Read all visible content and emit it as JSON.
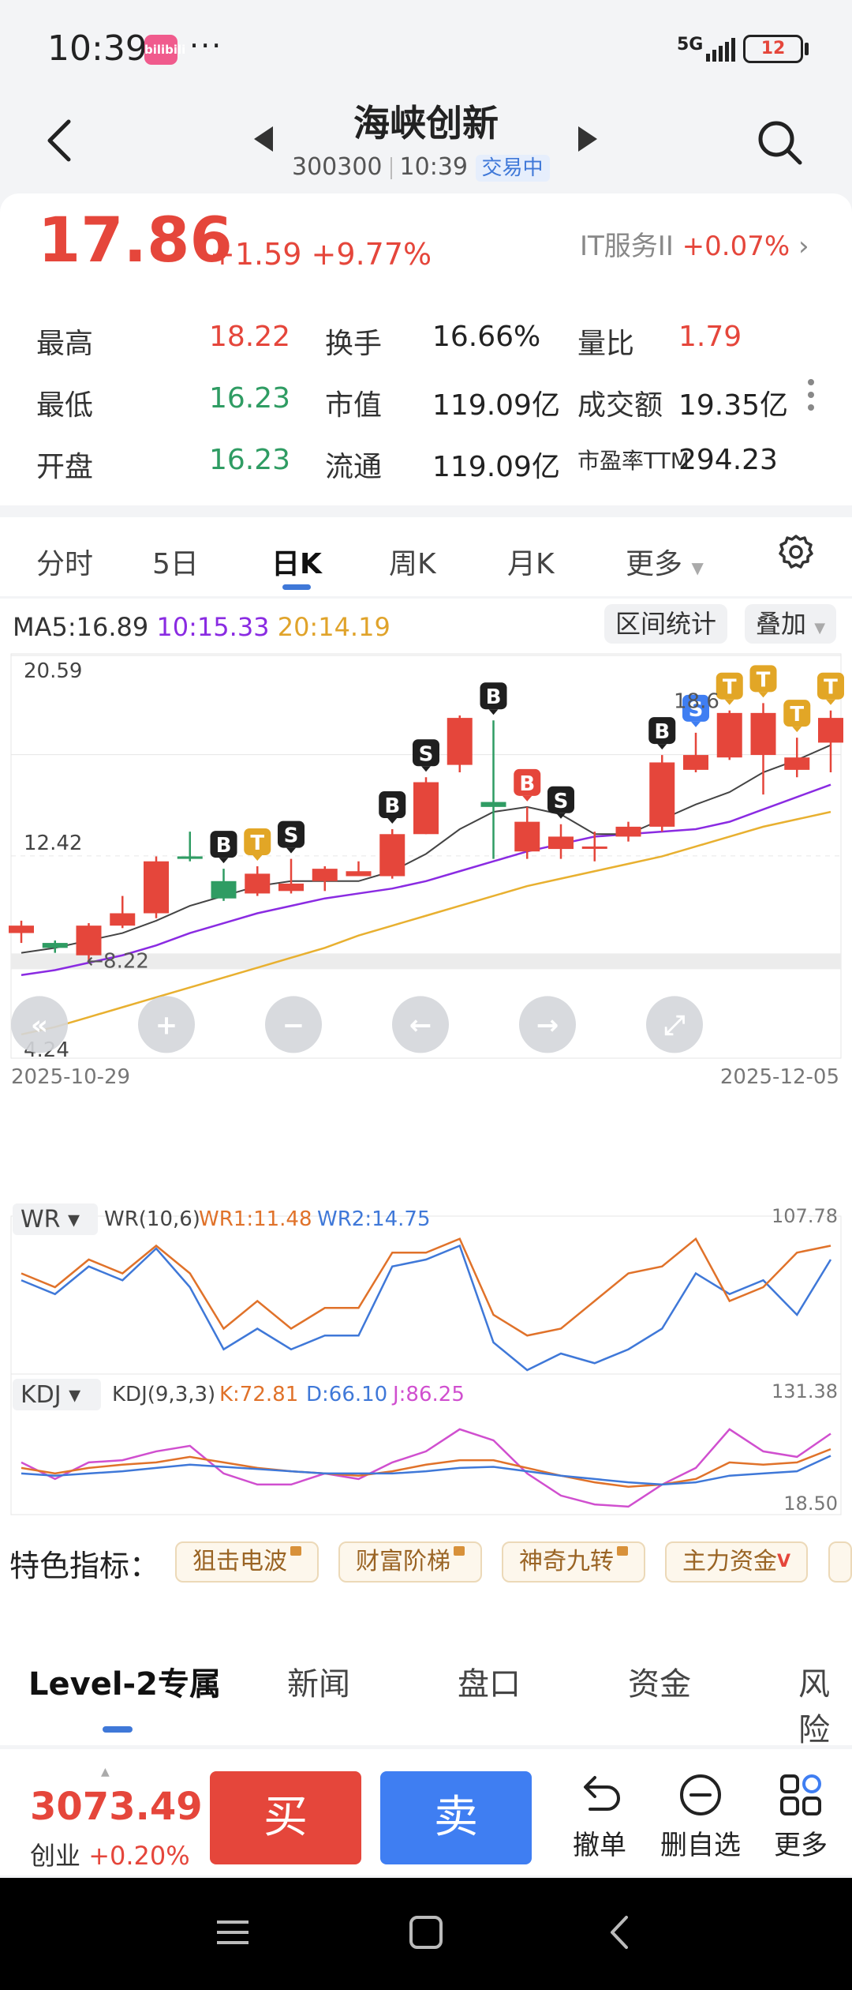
{
  "status": {
    "time": "10:39",
    "app_badge": "bilibili",
    "more": "···",
    "network": "5G",
    "battery": "12"
  },
  "header": {
    "name": "海峡创新",
    "code": "300300",
    "time": "10:39",
    "state": "交易中"
  },
  "quote": {
    "price": "17.86",
    "change": "+1.59",
    "change_pct": "+9.77%",
    "sector": "IT服务II",
    "sector_chg": "+0.07%",
    "rows": [
      {
        "l1": "最高",
        "v1": "18.22",
        "l2": "换手",
        "v2": "16.66%",
        "l3": "量比",
        "v3": "1.79"
      },
      {
        "l1": "最低",
        "v1": "16.23",
        "l2": "市值",
        "v2": "119.09亿",
        "l3": "成交额",
        "v3": "19.35亿"
      },
      {
        "l1": "开盘",
        "v1": "16.23",
        "l2": "流通",
        "v2": "119.09亿",
        "l3": "市盈率TTM",
        "v3": "294.23"
      }
    ]
  },
  "tabs": [
    "分时",
    "5日",
    "日K",
    "周K",
    "月K",
    "更多"
  ],
  "active_tab": "日K",
  "ma": {
    "ma5": "MA5:16.89",
    "ma10": "10:15.33",
    "ma20": "20:14.19",
    "range_btn": "区间统计",
    "overlay_btn": "叠加"
  },
  "chart_labels": {
    "ymax": "20.59",
    "ymid": "12.42",
    "ymin": "4.24",
    "low_mark": "8.22",
    "high_mark": "18.6",
    "date_start": "2025-10-29",
    "date_end": "2025-12-05"
  },
  "wr": {
    "name": "WR",
    "params": "WR(10,6)",
    "wr1": "WR1:11.48",
    "wr2": "WR2:14.75",
    "max": "107.78"
  },
  "kdj": {
    "name": "KDJ",
    "params": "KDJ(9,3,3)",
    "k": "K:72.81",
    "d": "D:66.10",
    "j": "J:86.25",
    "max": "131.38",
    "min": "18.50"
  },
  "features": {
    "label": "特色指标：",
    "chips": [
      "狙击电波",
      "财富阶梯",
      "神奇九转",
      "主力资金"
    ]
  },
  "news_tabs": [
    "Level-2专属",
    "新闻",
    "盘口",
    "资金",
    "风险"
  ],
  "bottom": {
    "index_value": "3073.49",
    "index_name": "创业",
    "index_chg": "+0.20%",
    "buy": "买",
    "sell": "卖",
    "actions": [
      "撤单",
      "删自选",
      "更多"
    ]
  },
  "colors": {
    "up": "#e5463b",
    "down": "#2f9c63",
    "ma5": "#444444",
    "ma10": "#8a2be2",
    "ma20": "#e8b030",
    "accent": "#3f78d8"
  },
  "chart_data": {
    "type": "candlestick",
    "ohlc": [
      [
        9.3,
        9.6,
        8.9,
        9.8
      ],
      [
        8.9,
        8.7,
        8.5,
        9.0
      ],
      [
        8.4,
        9.6,
        8.2,
        9.7
      ],
      [
        9.6,
        10.1,
        9.5,
        10.8
      ],
      [
        10.1,
        12.2,
        9.9,
        12.4
      ],
      [
        12.4,
        12.3,
        12.2,
        13.4
      ],
      [
        11.4,
        10.7,
        10.6,
        11.9
      ],
      [
        10.9,
        11.7,
        10.8,
        12.0
      ],
      [
        11.0,
        11.3,
        10.9,
        12.3
      ],
      [
        11.4,
        11.9,
        11.0,
        12.0
      ],
      [
        11.6,
        11.8,
        11.6,
        12.2
      ],
      [
        11.6,
        13.3,
        11.5,
        13.5
      ],
      [
        13.3,
        15.4,
        13.3,
        15.6
      ],
      [
        16.1,
        18.0,
        15.8,
        18.1
      ],
      [
        14.6,
        14.4,
        12.3,
        17.9
      ],
      [
        12.6,
        13.8,
        12.3,
        14.4
      ],
      [
        12.7,
        13.2,
        12.3,
        13.7
      ],
      [
        12.8,
        12.8,
        12.2,
        13.4
      ],
      [
        13.2,
        13.6,
        13.0,
        13.8
      ],
      [
        13.6,
        16.2,
        13.4,
        16.5
      ],
      [
        15.9,
        16.5,
        15.8,
        17.4
      ],
      [
        16.4,
        18.2,
        16.3,
        18.3
      ],
      [
        16.5,
        18.2,
        14.9,
        18.6
      ],
      [
        15.9,
        16.4,
        15.6,
        17.2
      ],
      [
        17.0,
        18.0,
        15.8,
        18.3
      ]
    ],
    "ma5": [
      8.5,
      8.7,
      9.0,
      9.3,
      9.8,
      10.4,
      10.8,
      11.2,
      11.4,
      11.4,
      11.4,
      11.8,
      12.5,
      13.5,
      14.2,
      14.4,
      14.1,
      13.3,
      13.3,
      13.9,
      14.5,
      15.0,
      15.8,
      16.3,
      16.9
    ],
    "ma10": [
      7.6,
      7.8,
      8.1,
      8.4,
      8.8,
      9.3,
      9.7,
      10.1,
      10.4,
      10.7,
      10.9,
      11.1,
      11.4,
      11.8,
      12.2,
      12.6,
      12.9,
      13.2,
      13.3,
      13.4,
      13.5,
      13.8,
      14.3,
      14.8,
      15.3
    ],
    "ma20": [
      5.2,
      5.5,
      5.9,
      6.3,
      6.7,
      7.1,
      7.5,
      7.9,
      8.3,
      8.7,
      9.2,
      9.6,
      10.0,
      10.4,
      10.8,
      11.2,
      11.5,
      11.8,
      12.1,
      12.4,
      12.8,
      13.2,
      13.6,
      13.9,
      14.2
    ],
    "markers": [
      {
        "i": 6,
        "label": "B",
        "color": "#1f1f1f"
      },
      {
        "i": 7,
        "label": "T",
        "color": "#e2a626"
      },
      {
        "i": 8,
        "label": "S",
        "color": "#1f1f1f"
      },
      {
        "i": 11,
        "label": "B",
        "color": "#1f1f1f"
      },
      {
        "i": 12,
        "label": "S",
        "color": "#1f1f1f"
      },
      {
        "i": 14,
        "label": "B",
        "color": "#1f1f1f"
      },
      {
        "i": 15,
        "label": "B",
        "color": "#e5463b"
      },
      {
        "i": 16,
        "label": "S",
        "color": "#1f1f1f"
      },
      {
        "i": 19,
        "label": "B",
        "color": "#1f1f1f"
      },
      {
        "i": 20,
        "label": "S",
        "color": "#3f7ef2"
      },
      {
        "i": 21,
        "label": "T",
        "color": "#e2a626"
      },
      {
        "i": 22,
        "label": "T",
        "color": "#e2a626"
      },
      {
        "i": 23,
        "label": "T",
        "color": "#e2a626"
      },
      {
        "i": 24,
        "label": "T",
        "color": "#e2a626"
      }
    ],
    "ylim": [
      4.24,
      20.59
    ],
    "wr1": [
      30,
      40,
      20,
      30,
      10,
      30,
      70,
      50,
      70,
      55,
      55,
      15,
      15,
      5,
      60,
      75,
      70,
      50,
      30,
      25,
      5,
      50,
      40,
      15,
      10
    ],
    "wr2": [
      35,
      45,
      25,
      35,
      12,
      40,
      85,
      70,
      85,
      75,
      75,
      25,
      20,
      10,
      80,
      100,
      88,
      95,
      85,
      70,
      30,
      45,
      35,
      60,
      20
    ],
    "k": [
      55,
      50,
      55,
      58,
      60,
      65,
      60,
      55,
      52,
      50,
      48,
      52,
      58,
      62,
      62,
      55,
      48,
      42,
      38,
      40,
      45,
      60,
      58,
      60,
      72
    ],
    "d": [
      50,
      48,
      50,
      52,
      55,
      58,
      56,
      54,
      52,
      50,
      50,
      50,
      52,
      55,
      56,
      52,
      48,
      45,
      42,
      40,
      42,
      48,
      50,
      52,
      66
    ],
    "j": [
      60,
      45,
      60,
      62,
      70,
      75,
      50,
      40,
      40,
      50,
      45,
      60,
      70,
      90,
      80,
      50,
      30,
      22,
      20,
      40,
      55,
      90,
      70,
      65,
      86
    ]
  }
}
